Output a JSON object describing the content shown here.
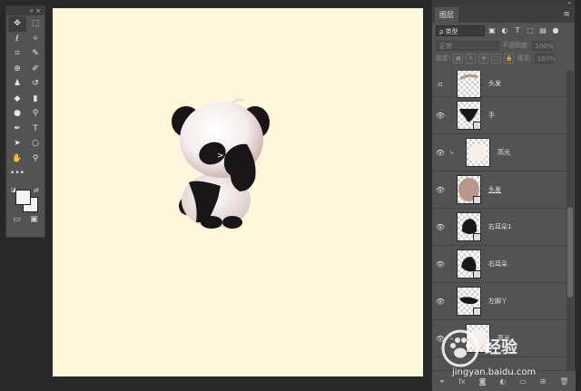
{
  "tools_panel": {
    "header": "«  ×",
    "tools": [
      {
        "name": "move-tool-icon",
        "glyph": "✥",
        "selected": true
      },
      {
        "name": "marquee-tool-icon",
        "glyph": "⬚"
      },
      {
        "name": "lasso-tool-icon",
        "glyph": "ℓ"
      },
      {
        "name": "magic-wand-tool-icon",
        "glyph": "✧"
      },
      {
        "name": "crop-tool-icon",
        "glyph": "⌗"
      },
      {
        "name": "eyedropper-tool-icon",
        "glyph": "✎"
      },
      {
        "name": "healing-brush-tool-icon",
        "glyph": "⊕"
      },
      {
        "name": "brush-tool-icon",
        "glyph": "✐"
      },
      {
        "name": "clone-stamp-tool-icon",
        "glyph": "♟"
      },
      {
        "name": "history-brush-tool-icon",
        "glyph": "↺"
      },
      {
        "name": "eraser-tool-icon",
        "glyph": "◆"
      },
      {
        "name": "gradient-tool-icon",
        "glyph": "▮"
      },
      {
        "name": "blur-tool-icon",
        "glyph": "●"
      },
      {
        "name": "dodge-tool-icon",
        "glyph": "⚲"
      },
      {
        "name": "pen-tool-icon",
        "glyph": "✒"
      },
      {
        "name": "type-tool-icon",
        "glyph": "T"
      },
      {
        "name": "path-selection-tool-icon",
        "glyph": "➤"
      },
      {
        "name": "ellipse-tool-icon",
        "glyph": "○"
      },
      {
        "name": "hand-tool-icon",
        "glyph": "✋"
      },
      {
        "name": "zoom-tool-icon",
        "glyph": "⚲"
      },
      {
        "name": "more-tools-icon",
        "glyph": "•••"
      }
    ],
    "bottom": [
      {
        "name": "quick-mask-icon",
        "glyph": "▭"
      },
      {
        "name": "screen-mode-icon",
        "glyph": "▣"
      }
    ]
  },
  "layers_panel": {
    "tab_label": "图层",
    "kind_filter": "ρ 类型",
    "filter_icons": [
      "image-filter-icon",
      "adjustment-filter-icon",
      "type-filter-icon",
      "shape-filter-icon",
      "smart-filter-icon",
      "toggle-filter-icon"
    ],
    "filter_glyphs": [
      "▣",
      "◐",
      "T",
      "⬚",
      "▤",
      "●"
    ],
    "blend_mode": "正常",
    "opacity_label": "不透明度:",
    "opacity_value": "100%",
    "lock_label": "锁定:",
    "fill_label": "填充:",
    "fill_value": "100%",
    "lock_glyphs": [
      "▦",
      "✎",
      "✥",
      "⬚",
      "🔒"
    ],
    "layers": [
      {
        "name": "头发",
        "visible": false,
        "clipped": false,
        "underline": false,
        "thumb": "hair-strip"
      },
      {
        "name": "手",
        "visible": true,
        "clipped": false,
        "underline": false,
        "thumb": "hand"
      },
      {
        "name": "高光",
        "visible": true,
        "clipped": true,
        "underline": false,
        "thumb": "highlight"
      },
      {
        "name": "头发",
        "visible": true,
        "clipped": false,
        "underline": true,
        "thumb": "head"
      },
      {
        "name": "右耳朵1",
        "visible": true,
        "clipped": false,
        "underline": false,
        "thumb": "ear"
      },
      {
        "name": "右耳朵",
        "visible": true,
        "clipped": false,
        "underline": false,
        "thumb": "ear2"
      },
      {
        "name": "左脚丫",
        "visible": true,
        "clipped": false,
        "underline": false,
        "thumb": "foot"
      },
      {
        "name": "高光",
        "visible": true,
        "clipped": true,
        "underline": false,
        "thumb": "highlight"
      }
    ],
    "footer_icons": [
      "link-layers-icon",
      "fx-icon",
      "mask-icon",
      "adjustment-icon",
      "group-icon",
      "new-layer-icon",
      "trash-icon"
    ],
    "footer_glyphs": [
      "⚭",
      "fx",
      "◙",
      "◐",
      "▭",
      "⊞",
      "🗑"
    ]
  },
  "watermark": {
    "brand": "经验",
    "url": "jingyan.baidu.com"
  },
  "colors": {
    "canvas_bg": "#fff8dc",
    "panel": "#535353",
    "workspace": "#282828"
  }
}
